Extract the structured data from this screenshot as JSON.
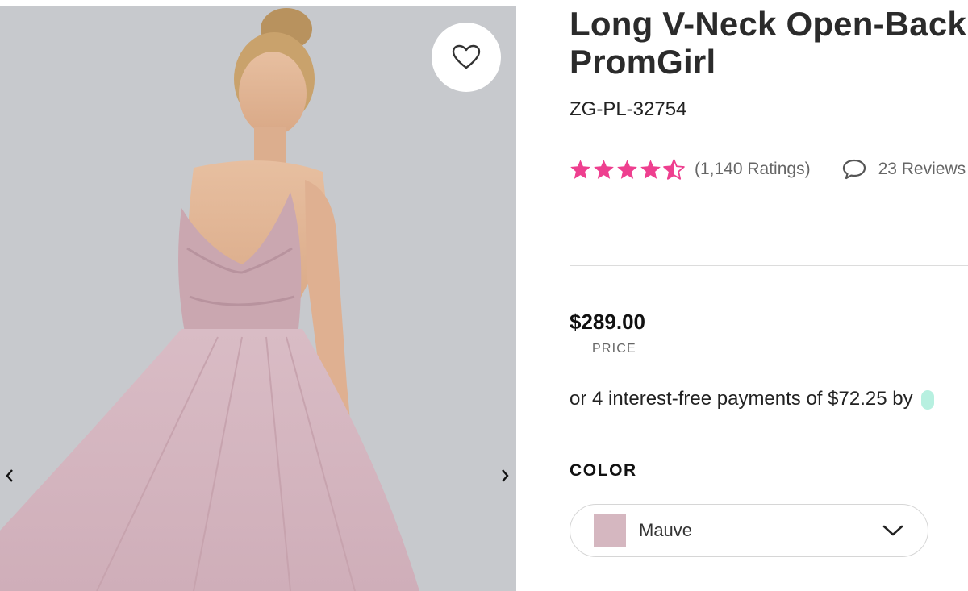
{
  "gallery": {
    "favorite_icon": "heart-outline-icon",
    "prev_icon": "chevron-left-icon",
    "next_icon": "chevron-right-icon",
    "background": "#c7c9cd",
    "dress_color": "#d6b8c2"
  },
  "product": {
    "title_line1": "Long V-Neck Open-Back",
    "title_line2": "PromGirl",
    "sku": "ZG-PL-32754",
    "rating": {
      "value": 4.5,
      "max": 5,
      "star_color": "#ee3f8f"
    },
    "ratings_count": "(1,140 Ratings)",
    "reviews_icon": "speech-bubble-icon",
    "reviews_text": "23 Reviews",
    "price": "$289.00",
    "price_label": "PRICE",
    "installments_text": "or 4 interest-free payments of $72.25 by"
  },
  "color": {
    "heading": "COLOR",
    "selected": "Mauve",
    "swatch_color": "#d5b7c0",
    "dropdown_icon": "chevron-down-icon"
  }
}
